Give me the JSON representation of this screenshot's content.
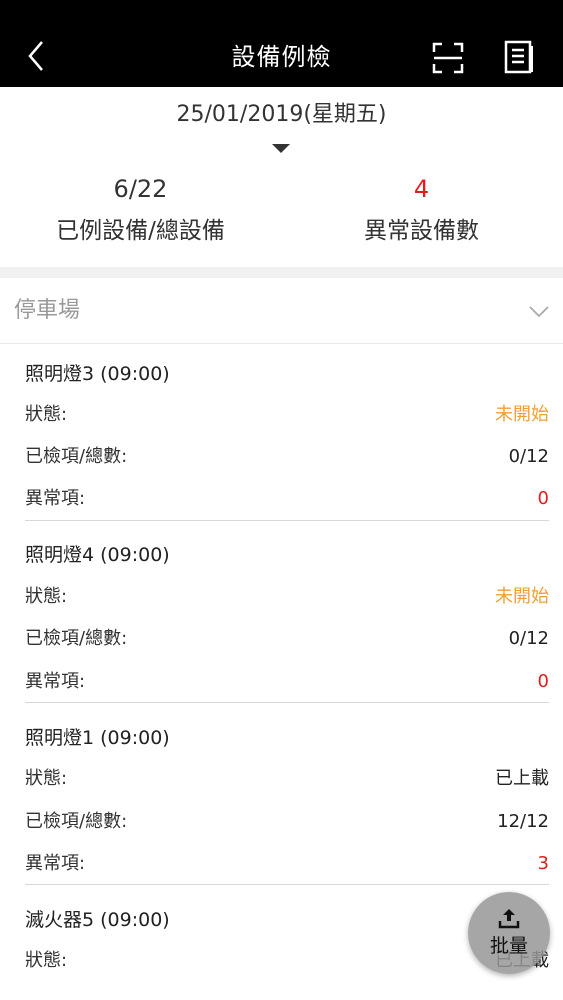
{
  "header": {
    "title": "設備例檢",
    "back_icon": "chevron-left-icon",
    "scan_icon": "scan-icon",
    "report_icon": "report-list-icon"
  },
  "date": {
    "label": "25/01/2019(星期五)"
  },
  "stats": {
    "checked_value": "6/22",
    "checked_label": "已例設備/總設備",
    "abnormal_value": "4",
    "abnormal_label": "異常設備數"
  },
  "section": {
    "label": "停車場"
  },
  "field_labels": {
    "status": "狀態:",
    "checked": "已檢項/總數:",
    "abnormal": "異常項:"
  },
  "cards": [
    {
      "name": "照明燈3 (09:00)",
      "status": "未開始",
      "checked": "0/12",
      "abnormal": "0"
    },
    {
      "name": "照明燈4 (09:00)",
      "status": "未開始",
      "checked": "0/12",
      "abnormal": "0"
    },
    {
      "name": "照明燈1 (09:00)",
      "status": "已上載",
      "checked": "12/12",
      "abnormal": "3"
    },
    {
      "name": "滅火器5 (09:00)",
      "status": "已上載"
    }
  ],
  "fab": {
    "label": "批量",
    "icon": "upload-icon"
  },
  "colors": {
    "header_bg": "#000000",
    "not_started": "#f0a030",
    "abnormal": "#e21d1d"
  }
}
